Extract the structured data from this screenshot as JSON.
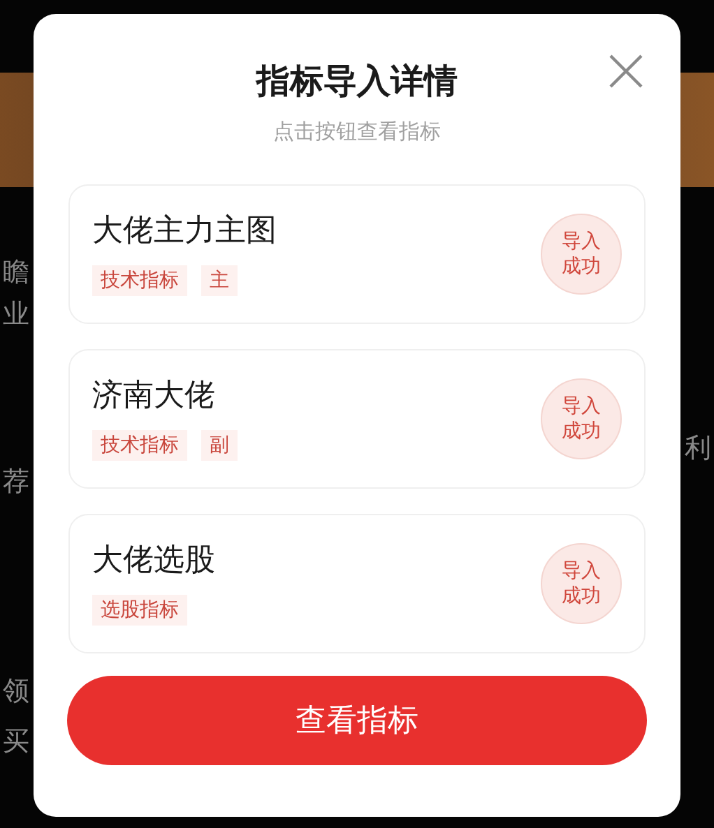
{
  "backdrop": {
    "left_texts": [
      "瞻",
      "业",
      "荐",
      "领",
      "买"
    ],
    "right_texts": [
      "利"
    ]
  },
  "dialog": {
    "title": "指标导入详情",
    "subtitle": "点击按钮查看指标",
    "indicators": [
      {
        "name": "大佬主力主图",
        "tags": [
          "技术指标",
          "主"
        ],
        "status": "导入成功"
      },
      {
        "name": "济南大佬",
        "tags": [
          "技术指标",
          "副"
        ],
        "status": "导入成功"
      },
      {
        "name": "大佬选股",
        "tags": [
          "选股指标"
        ],
        "status": "导入成功"
      }
    ],
    "button": "查看指标"
  }
}
